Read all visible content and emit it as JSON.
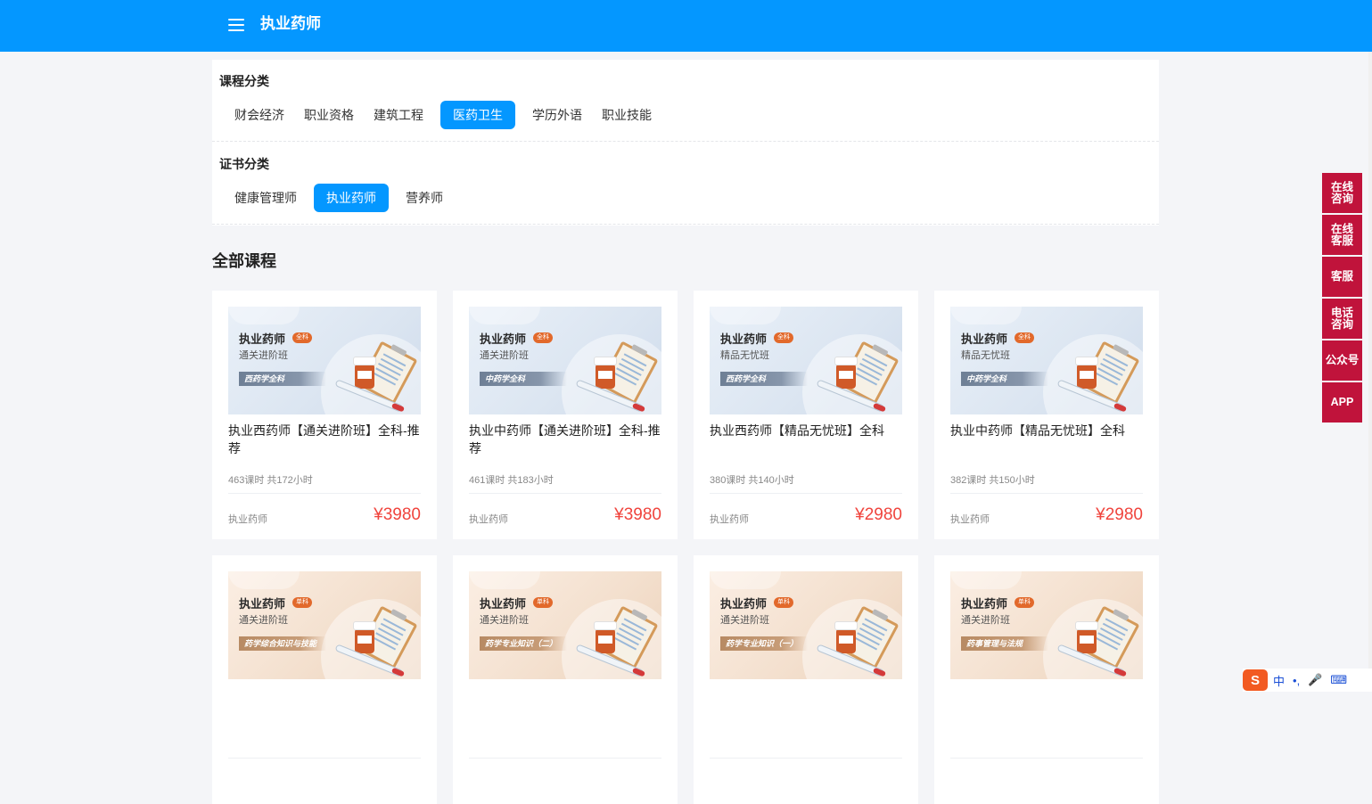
{
  "header": {
    "title": "执业药师"
  },
  "course_filter": {
    "heading": "课程分类",
    "items": [
      {
        "label": "财会经济",
        "active": false
      },
      {
        "label": "职业资格",
        "active": false
      },
      {
        "label": "建筑工程",
        "active": false
      },
      {
        "label": "医药卫生",
        "active": true
      },
      {
        "label": "学历外语",
        "active": false
      },
      {
        "label": "职业技能",
        "active": false
      }
    ]
  },
  "cert_filter": {
    "heading": "证书分类",
    "items": [
      {
        "label": "健康管理师",
        "active": false
      },
      {
        "label": "执业药师",
        "active": true
      },
      {
        "label": "营养师",
        "active": false
      }
    ]
  },
  "main": {
    "section_title": "全部课程"
  },
  "courses": [
    {
      "thumb_name": "执业药师",
      "thumb_badge": "全科",
      "thumb_sub": "通关进阶班",
      "thumb_tag": "西药学全科",
      "theme": "blue",
      "title": "执业西药师【通关进阶班】全科-推荐",
      "meta": "463课时 共172小时",
      "category": "执业药师",
      "price": "¥3980"
    },
    {
      "thumb_name": "执业药师",
      "thumb_badge": "全科",
      "thumb_sub": "通关进阶班",
      "thumb_tag": "中药学全科",
      "theme": "blue",
      "title": "执业中药师【通关进阶班】全科-推荐",
      "meta": "461课时 共183小时",
      "category": "执业药师",
      "price": "¥3980"
    },
    {
      "thumb_name": "执业药师",
      "thumb_badge": "全科",
      "thumb_sub": "精品无忧班",
      "thumb_tag": "西药学全科",
      "theme": "blue",
      "title": "执业西药师【精品无忧班】全科",
      "meta": "380课时 共140小时",
      "category": "执业药师",
      "price": "¥2980"
    },
    {
      "thumb_name": "执业药师",
      "thumb_badge": "全科",
      "thumb_sub": "精品无忧班",
      "thumb_tag": "中药学全科",
      "theme": "blue",
      "title": "执业中药师【精品无忧班】全科",
      "meta": "382课时 共150小时",
      "category": "执业药师",
      "price": "¥2980"
    },
    {
      "thumb_name": "执业药师",
      "thumb_badge": "单科",
      "thumb_sub": "通关进阶班",
      "thumb_tag": "药学综合知识与技能",
      "theme": "orange",
      "title": "",
      "meta": "",
      "category": "",
      "price": ""
    },
    {
      "thumb_name": "执业药师",
      "thumb_badge": "单科",
      "thumb_sub": "通关进阶班",
      "thumb_tag": "药学专业知识（二）",
      "theme": "orange",
      "title": "",
      "meta": "",
      "category": "",
      "price": ""
    },
    {
      "thumb_name": "执业药师",
      "thumb_badge": "单科",
      "thumb_sub": "通关进阶班",
      "thumb_tag": "药学专业知识（一）",
      "theme": "orange",
      "title": "",
      "meta": "",
      "category": "",
      "price": ""
    },
    {
      "thumb_name": "执业药师",
      "thumb_badge": "单科",
      "thumb_sub": "通关进阶班",
      "thumb_tag": "药事管理与法规",
      "theme": "orange",
      "title": "",
      "meta": "",
      "category": "",
      "price": ""
    }
  ],
  "float_bar": [
    {
      "label": "在线\n咨询"
    },
    {
      "label": "在线\n客服"
    },
    {
      "label": "客服"
    },
    {
      "label": "电话\n咨询"
    },
    {
      "label": "公众号"
    },
    {
      "label": "APP"
    }
  ],
  "ime": {
    "logo": "S",
    "mode": "中",
    "punct": "•,"
  },
  "colors": {
    "primary": "#0497ff",
    "price": "#f0443d",
    "float_bar": "#c0133b"
  }
}
